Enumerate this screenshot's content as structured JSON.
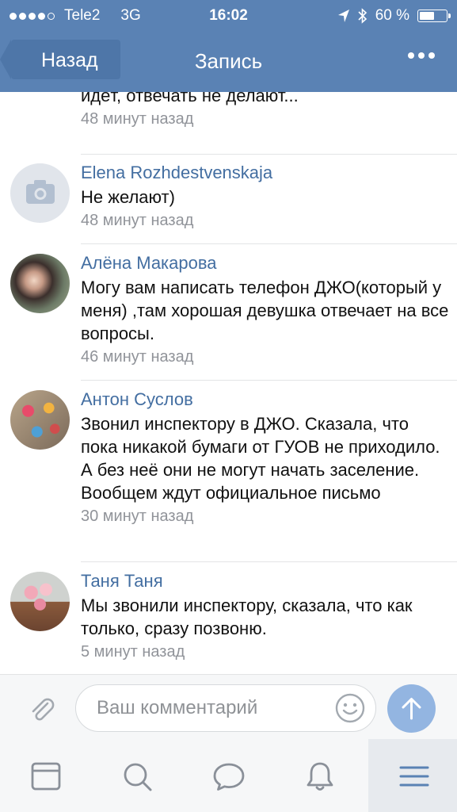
{
  "status_bar": {
    "carrier": "Tele2",
    "network": "3G",
    "time": "16:02",
    "battery": "60 %",
    "battery_level": 0.6
  },
  "nav": {
    "back_label": "Назад",
    "title": "Запись"
  },
  "comments": [
    {
      "name": "",
      "text": "идёт, отвечать не делают...",
      "time": "48 минут назад"
    },
    {
      "name": "Elena Rozhdestvenskaja",
      "text": "Не желают)",
      "time": "48 минут назад"
    },
    {
      "name": "Алёна Макарова",
      "text": "Могу вам написать телефон ДЖО(который у меня) ,там хорошая девушка отвечает на все вопросы.",
      "time": "46 минут назад"
    },
    {
      "name": "Антон Суслов",
      "text": "Звонил инспектору в ДЖО. Сказала, что пока никакой бумаги от ГУОВ не приходило. А без неё они не могут начать заселение. Вообщем ждут официальное письмо",
      "time": "30 минут назад"
    },
    {
      "name": "Таня Таня",
      "text": "Мы звонили инспектору, сказала, что как только, сразу позвоню.",
      "time": "5 минут назад"
    }
  ],
  "composer": {
    "placeholder": "Ваш комментарий"
  },
  "colors": {
    "header": "#5a82b4",
    "link": "#436ea1",
    "send": "#93b5e1",
    "tab_icon": "#8a9099",
    "tab_active_icon": "#5a82b4"
  },
  "tabs": [
    {
      "icon": "news-icon",
      "active": false
    },
    {
      "icon": "search-icon",
      "active": false
    },
    {
      "icon": "messages-icon",
      "active": false
    },
    {
      "icon": "notifications-icon",
      "active": false
    },
    {
      "icon": "menu-icon",
      "active": true
    }
  ]
}
